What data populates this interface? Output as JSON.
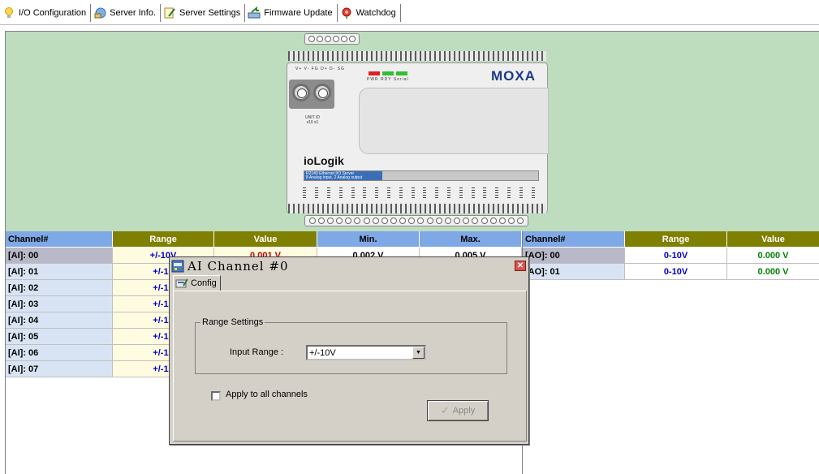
{
  "tabs": [
    {
      "label": "I/O Configuration",
      "icon": "lightbulb-icon"
    },
    {
      "label": "Server Info.",
      "icon": "server-info-icon"
    },
    {
      "label": "Server Settings",
      "icon": "settings-icon"
    },
    {
      "label": "Firmware Update",
      "icon": "firmware-update-icon"
    },
    {
      "label": "Watchdog",
      "icon": "watchdog-icon"
    }
  ],
  "device": {
    "brand": "MOXA",
    "product": "ioLogik",
    "model_line1": "R2140 Ethernet I/O Server",
    "model_line2": "8 Analog input, 2 Analog output",
    "power_labels": "V+ V- FG D+ D- SG",
    "led_labels": "PWR RDY Serial",
    "unit_label": "UNIT ID",
    "unit_sub": "x10 x1"
  },
  "ai_table": {
    "headers": [
      "Channel#",
      "Range",
      "Value",
      "Min.",
      "Max."
    ],
    "rows": [
      {
        "channel": "[AI]: 00",
        "range": "+/-10V",
        "value": "0.001 V",
        "min": "0.002 V",
        "max": "0.005 V"
      },
      {
        "channel": "[AI]: 01",
        "range": "+/-10",
        "value": "",
        "min": "",
        "max": ""
      },
      {
        "channel": "[AI]: 02",
        "range": "+/-10",
        "value": "",
        "min": "",
        "max": ""
      },
      {
        "channel": "[AI]: 03",
        "range": "+/-10",
        "value": "",
        "min": "",
        "max": ""
      },
      {
        "channel": "[AI]: 04",
        "range": "+/-10",
        "value": "",
        "min": "",
        "max": ""
      },
      {
        "channel": "[AI]: 05",
        "range": "+/-10",
        "value": "",
        "min": "",
        "max": ""
      },
      {
        "channel": "[AI]: 06",
        "range": "+/-10",
        "value": "",
        "min": "",
        "max": ""
      },
      {
        "channel": "[AI]: 07",
        "range": "+/-10",
        "value": "",
        "min": "",
        "max": ""
      }
    ]
  },
  "ao_table": {
    "headers": [
      "Channel#",
      "Range",
      "Value"
    ],
    "rows": [
      {
        "channel": "[AO]: 00",
        "range": "0-10V",
        "value": "0.000 V"
      },
      {
        "channel": "[AO]: 01",
        "range": "0-10V",
        "value": "0.000 V"
      }
    ]
  },
  "dialog": {
    "title": "AI Channel #0",
    "tab_label": "Config",
    "group_label": "Range Settings",
    "input_range_label": "Input Range :",
    "input_range_value": "+/-10V",
    "apply_all_label": "Apply to all channels",
    "apply_all_checked": false,
    "apply_button": "Apply",
    "apply_enabled": false
  },
  "colors": {
    "device_bg": "#bedcbe",
    "header_blue": "#7fa8e6",
    "header_olive": "#808000",
    "value_red": "#cc0000",
    "range_blue": "#0000cc",
    "ao_value_green": "#008000"
  }
}
